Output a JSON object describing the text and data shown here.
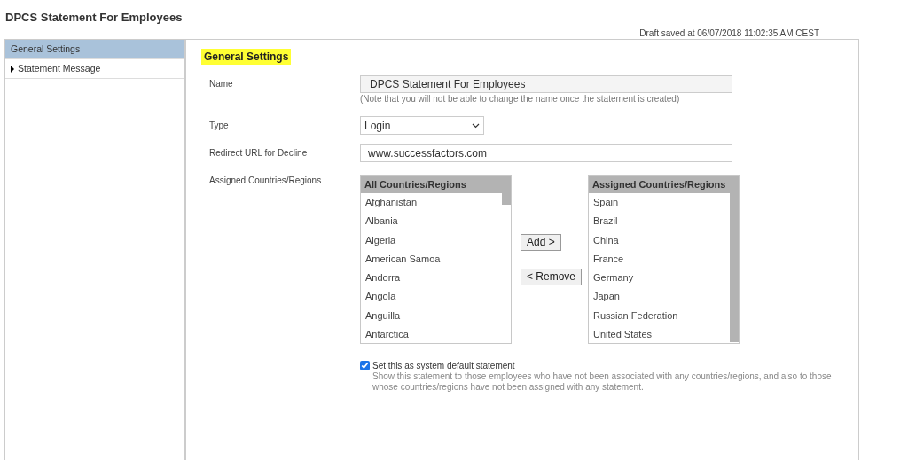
{
  "page_title": "DPCS Statement For Employees",
  "draft_status": "Draft saved at 06/07/2018 11:02:35 AM CEST",
  "sidebar": {
    "items": [
      {
        "label": "General Settings",
        "selected": true,
        "expandable": false
      },
      {
        "label": "Statement Message",
        "selected": false,
        "expandable": true
      }
    ]
  },
  "section_title": "General Settings",
  "form": {
    "name": {
      "label": "Name",
      "value": "DPCS Statement For Employees",
      "note": "(Note that you will not be able to change the name once the statement is created)"
    },
    "type": {
      "label": "Type",
      "value": "Login"
    },
    "redirect": {
      "label": "Redirect URL for Decline",
      "value": "www.successfactors.com"
    },
    "countries": {
      "label": "Assigned Countries/Regions",
      "all_list": {
        "header": "All Countries/Regions",
        "items": [
          "Afghanistan",
          "Albania",
          "Algeria",
          "American Samoa",
          "Andorra",
          "Angola",
          "Anguilla",
          "Antarctica"
        ]
      },
      "assigned_list": {
        "header": "Assigned Countries/Regions",
        "items": [
          "Spain",
          "Brazil",
          "China",
          "France",
          "Germany",
          "Japan",
          "Russian Federation",
          "United States"
        ]
      },
      "add_button": "Add >",
      "remove_button": "< Remove"
    },
    "default_statement": {
      "label": "Set this as system default statement",
      "checked": true,
      "description": "Show this statement to those employees who have not been associated with any countries/regions, and also to those whose countries/regions have not been assigned with any statement."
    }
  }
}
